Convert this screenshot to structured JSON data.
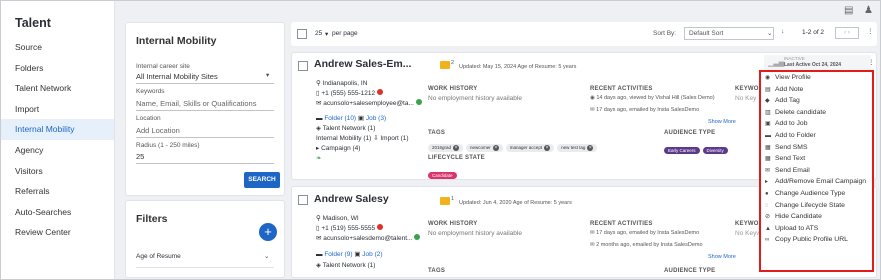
{
  "sidebar": {
    "title": "Talent",
    "items": [
      {
        "label": "Source"
      },
      {
        "label": "Folders"
      },
      {
        "label": "Talent Network"
      },
      {
        "label": "Import"
      },
      {
        "label": "Internal Mobility"
      },
      {
        "label": "Agency"
      },
      {
        "label": "Visitors"
      },
      {
        "label": "Referrals"
      },
      {
        "label": "Auto-Searches"
      },
      {
        "label": "Review Center"
      }
    ]
  },
  "mobility": {
    "title": "Internal Mobility",
    "career_site_label": "Internal career site",
    "career_site_value": "All Internal Mobility Sites",
    "keywords_label": "Keywords",
    "keywords_placeholder": "Name, Email, Skills or Qualifications",
    "location_label": "Location",
    "location_placeholder": "Add Location",
    "radius_label": "Radius (1 - 250 miles)",
    "radius_value": "25",
    "search_label": "SEARCH"
  },
  "filters": {
    "title": "Filters",
    "age_label": "Age of Resume"
  },
  "toolbar": {
    "per_page": "25",
    "per_page_label": "per page",
    "sort_label": "Sort By:",
    "sort_value": "Default Sort",
    "pagination": "1-2 of 2"
  },
  "candidates": [
    {
      "name": "Andrew Sales-Em...",
      "count": "2",
      "updated": "Updated: May 15, 2024  Age of Resume: 5 years",
      "location": "Indianapolis, IN",
      "phone": "+1 (555) 555-1212",
      "email": "acunsolo+salesemployee@ta...",
      "folder": "Folder (10)",
      "job": "Job (3)",
      "network": "Talent Network (1)",
      "mobility": "Internal Mobility (1)",
      "import": "Import (1)",
      "campaign": "Campaign (4)",
      "work_history_label": "WORK HISTORY",
      "work_history": "No employment history available",
      "recent_label": "RECENT ACTIVITIES",
      "activity_1": "14 days ago, viewed by Vishal Hill (Sales Demo)",
      "activity_2": "17 days ago, emailed by Insta SalesDemo",
      "show_more": "Show More",
      "keywords_label": "KEYWO",
      "keywords_value": "No Key",
      "tags_label": "TAGS",
      "tags": [
        "2016grad",
        "newcomer",
        "manager accept",
        "new test tag"
      ],
      "audience_label": "AUDIENCE TYPE",
      "audience": [
        "Early Careers",
        "Diversity"
      ],
      "lifecycle_label": "LIFECYCLE STATE",
      "lifecycle": "Candidate",
      "inactive": "INACTIVE",
      "last_active": "Last Active Oct 24, 2024"
    },
    {
      "name": "Andrew Salesy",
      "count": "1",
      "updated": "Updated: Jun 4, 2020  Age of Resume: 5 years",
      "location": "Madison, WI",
      "phone": "+1 (519) 555-5555",
      "email": "acunsolo+salesdemo@talent...",
      "folder": "Folder (9)",
      "job": "Job (2)",
      "network": "Talent Network (1)",
      "work_history_label": "WORK HISTORY",
      "work_history": "No employment history available",
      "recent_label": "RECENT ACTIVITIES",
      "activity_1": "17 days ago, emailed by Insta SalesDemo",
      "activity_2": "2 months ago, emailed by Insta SalesDemo",
      "show_more": "Show More",
      "keywords_label": "KEYWO",
      "keywords_value": "No Keyw",
      "tags_label": "TAGS",
      "audience_label": "AUDIENCE TYPE"
    }
  ],
  "context_menu": [
    {
      "label": "View Profile",
      "icon": "eye-icon",
      "glyph": "◉"
    },
    {
      "label": "Add Note",
      "icon": "note-icon",
      "glyph": "▤"
    },
    {
      "label": "Add Tag",
      "icon": "tag-icon",
      "glyph": "◆"
    },
    {
      "label": "Delete candidate",
      "icon": "trash-icon",
      "glyph": "▥"
    },
    {
      "label": "Add to Job",
      "icon": "briefcase-icon",
      "glyph": "▣"
    },
    {
      "label": "Add to Folder",
      "icon": "folder-icon",
      "glyph": "▬"
    },
    {
      "label": "Send SMS",
      "icon": "sms-icon",
      "glyph": "▦"
    },
    {
      "label": "Send Text",
      "icon": "text-icon",
      "glyph": "▦"
    },
    {
      "label": "Send Email",
      "icon": "email-icon",
      "glyph": "✉"
    },
    {
      "label": "Add/Remove Email Campaign",
      "icon": "campaign-icon",
      "glyph": "▸"
    },
    {
      "label": "Change Audience Type",
      "icon": "audience-icon",
      "glyph": "●"
    },
    {
      "label": "Change Lifecycle State",
      "icon": "lifecycle-icon",
      "glyph": "◌"
    },
    {
      "label": "Hide Candidate",
      "icon": "hide-icon",
      "glyph": "⊘"
    },
    {
      "label": "Upload to ATS",
      "icon": "upload-icon",
      "glyph": "▲"
    },
    {
      "label": "Copy Public Profile URL",
      "icon": "link-icon",
      "glyph": "∞"
    }
  ],
  "colors": {
    "accent": "#1e66c6",
    "highlight_border": "#e41b1b",
    "lifecycle": "#d9356b",
    "audience": "#5b3a8c"
  }
}
